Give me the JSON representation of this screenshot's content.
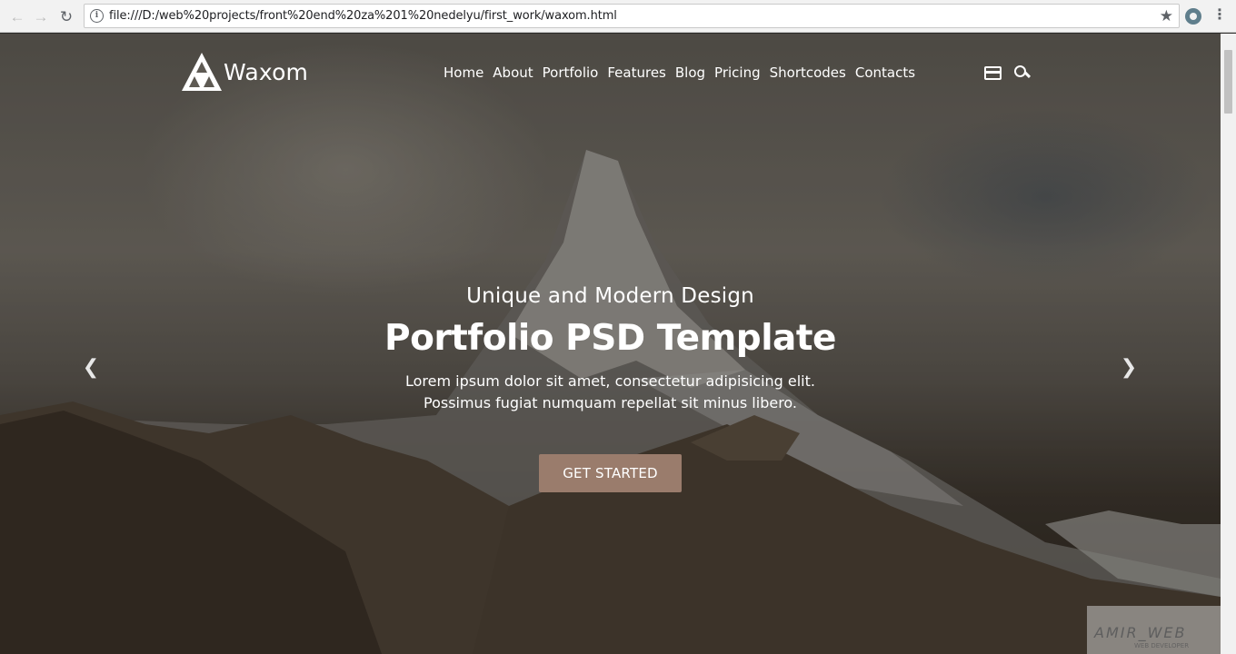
{
  "browser": {
    "url": "file:///D:/web%20projects/front%20end%20za%201%20nedelyu/first_work/waxom.html",
    "back_icon": "back-arrow-icon",
    "forward_icon": "forward-arrow-icon",
    "reload_icon": "reload-icon",
    "info_glyph": "i",
    "star_glyph": "★",
    "menu_glyph": "⋮"
  },
  "header": {
    "logo_text": "Waxom",
    "nav": [
      "Home",
      "About",
      "Portfolio",
      "Features",
      "Blog",
      "Pricing",
      "Shortcodes",
      "Contacts"
    ]
  },
  "hero": {
    "subtitle": "Unique and Modern Design",
    "title": "Portfolio PSD Template",
    "text_line1": "Lorem ipsum dolor sit amet, consectetur adipisicing elit.",
    "text_line2": "Possimus fugiat numquam repellat sit minus libero.",
    "cta": "GET STARTED",
    "prev_glyph": "❮",
    "next_glyph": "❯"
  },
  "watermark": {
    "text": "AMIR_WEB",
    "sub": "WEB DEVELOPER"
  },
  "colors": {
    "cta_background": "#9a7c6c",
    "text": "#ffffff"
  }
}
